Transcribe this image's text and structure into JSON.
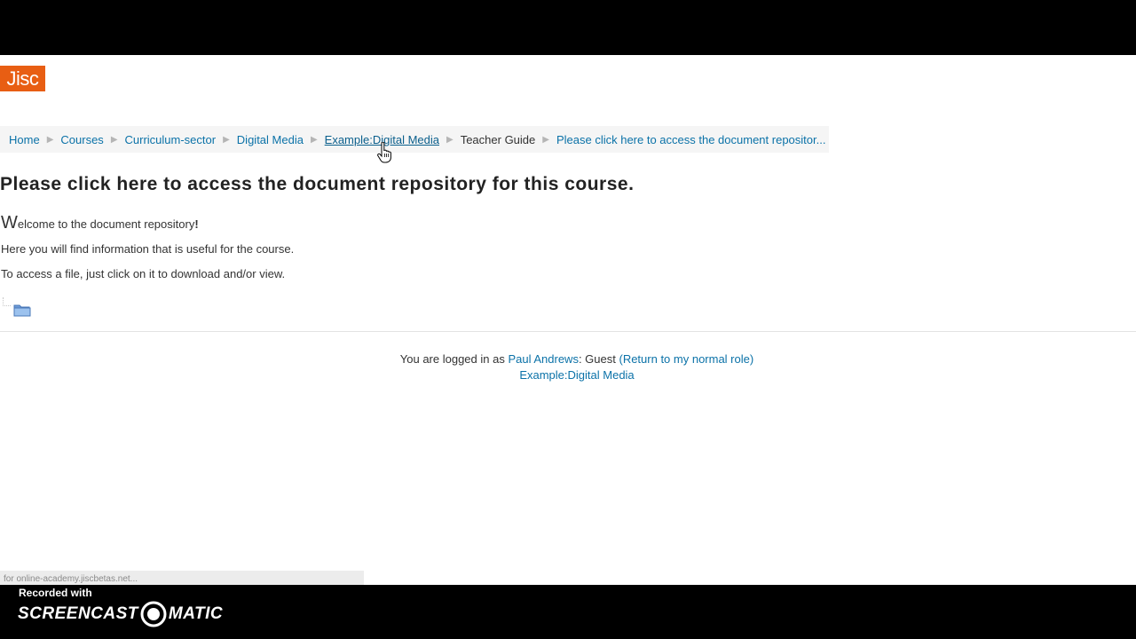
{
  "logo": {
    "text": "Jisc",
    "color": "#e85e13"
  },
  "breadcrumb": {
    "items": [
      {
        "label": "Home"
      },
      {
        "label": "Courses"
      },
      {
        "label": "Curriculum-sector"
      },
      {
        "label": "Digital Media"
      },
      {
        "label": "Example:Digital Media"
      },
      {
        "label": "Teacher Guide"
      },
      {
        "label": "Please click here to access the document repositor..."
      }
    ],
    "separator": "▶"
  },
  "page": {
    "title": "Please click here to access the document repository for this course.",
    "intro_line1_first": "W",
    "intro_line1_rest": "elcome to the document repository",
    "intro_line1_end": "!",
    "intro_line2": "Here you will find information that is useful for the course.",
    "intro_line3": "To access a file, just click on it to download and/or view."
  },
  "footer": {
    "logged_in_prefix": "You are logged in as ",
    "user_name": "Paul Andrews",
    "role_text": ": Guest ",
    "return_link": "(Return to my normal role)",
    "course_link": "Example:Digital Media"
  },
  "status_bar": {
    "text": "for online-academy.jiscbetas.net..."
  },
  "watermark": {
    "recorded_with": "Recorded with",
    "brand_left": "SCREENCAST",
    "brand_right": "MATIC"
  },
  "icons": {
    "folder": "folder-icon",
    "cursor": "hand-pointer-cursor-icon",
    "record": "screencast-o-icon"
  },
  "colors": {
    "link": "#0b72a8",
    "breadcrumb_bg": "#f5f5f5",
    "frame": "#000000"
  }
}
